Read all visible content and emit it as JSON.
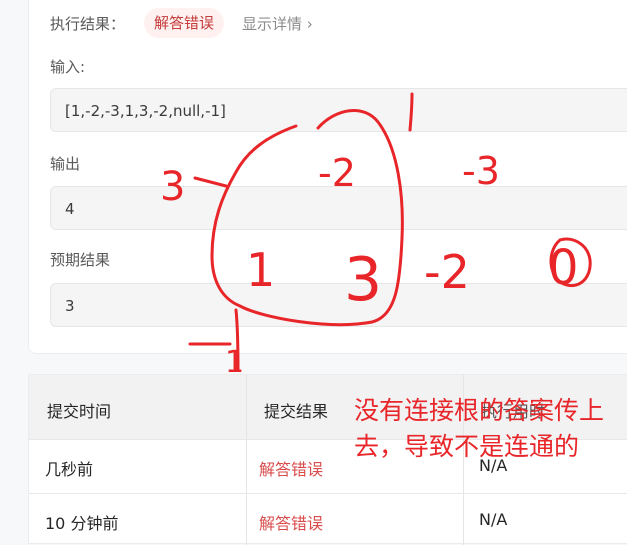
{
  "result": {
    "label": "执行结果：",
    "status": "解答错误",
    "details_link": "显示详情 ›"
  },
  "input": {
    "label": "输入:",
    "value": "[1,-2,-3,1,3,-2,null,-1]"
  },
  "output": {
    "label": "输出",
    "value": "4"
  },
  "expected": {
    "label": "预期结果",
    "value": "3"
  },
  "submissions": {
    "headers": [
      "提交时间",
      "提交结果",
      "执行用时"
    ],
    "rows": [
      {
        "time": "几秒前",
        "result": "解答错误",
        "runtime": "N/A"
      },
      {
        "time": "10 分钟前",
        "result": "解答错误",
        "runtime": "N/A"
      }
    ]
  },
  "annotation": {
    "numbers": [
      "3",
      "-2",
      "-3",
      "1",
      "3",
      "-2",
      "0",
      "1"
    ],
    "note": "没有连接根的答案传上去，导致不是连通的",
    "color": "#e8262a"
  }
}
